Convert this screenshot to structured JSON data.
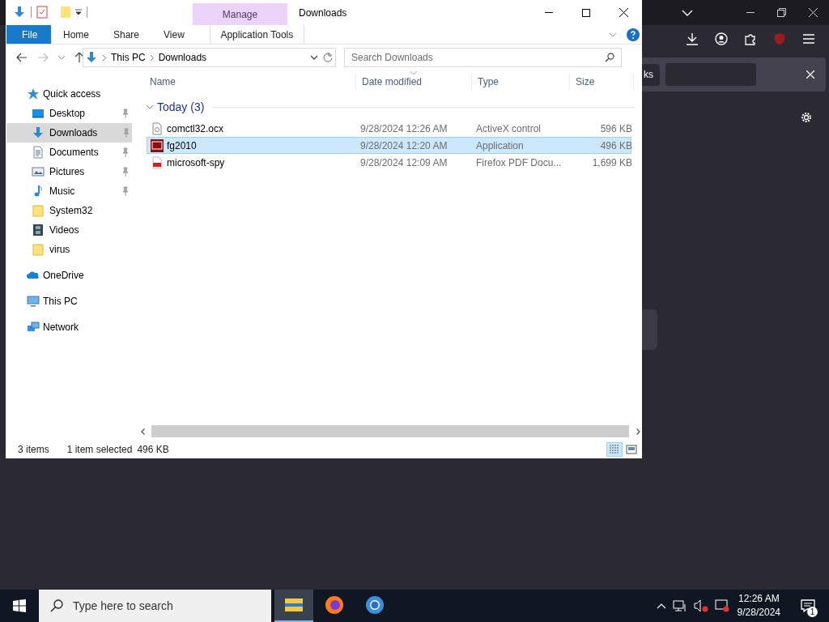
{
  "explorer": {
    "title": "Downloads",
    "context_group": "Manage",
    "ribbon_tabs": [
      {
        "label": "File",
        "kind": "file"
      },
      {
        "label": "Home",
        "kind": "tab"
      },
      {
        "label": "Share",
        "kind": "tab"
      },
      {
        "label": "View",
        "kind": "tab"
      },
      {
        "label": "Application Tools",
        "kind": "context"
      }
    ],
    "address": [
      "This PC",
      "Downloads"
    ],
    "search": {
      "placeholder": "Search Downloads"
    },
    "nav": [
      {
        "label": "Quick access",
        "kind": "star",
        "selected": false,
        "children": [
          {
            "label": "Desktop",
            "kind": "desktop",
            "pinned": true,
            "selected": false
          },
          {
            "label": "Downloads",
            "kind": "downloads",
            "pinned": true,
            "selected": true
          },
          {
            "label": "Documents",
            "kind": "documents",
            "pinned": true,
            "selected": false
          },
          {
            "label": "Pictures",
            "kind": "pictures",
            "pinned": true,
            "selected": false
          },
          {
            "label": "Music",
            "kind": "music",
            "pinned": true,
            "selected": false
          },
          {
            "label": "System32",
            "kind": "folder",
            "pinned": false,
            "selected": false
          },
          {
            "label": "Videos",
            "kind": "videos",
            "pinned": false,
            "selected": false
          },
          {
            "label": "virus",
            "kind": "folder",
            "pinned": false,
            "selected": false
          }
        ]
      },
      {
        "label": "OneDrive",
        "kind": "cloud",
        "selected": false
      },
      {
        "label": "This PC",
        "kind": "pc",
        "selected": false
      },
      {
        "label": "Network",
        "kind": "network",
        "selected": false
      }
    ],
    "columns": [
      "Name",
      "Date modified",
      "Type",
      "Size"
    ],
    "group": {
      "label": "Today (3)",
      "expanded": true
    },
    "rows": [
      {
        "kind": "ocx",
        "name": "comctl32.ocx",
        "date": "9/28/2024 12:26 AM",
        "type": "ActiveX control",
        "size": "596 KB",
        "selected": false
      },
      {
        "kind": "app",
        "name": "fg2010",
        "date": "9/28/2024 12:20 AM",
        "type": "Application",
        "size": "496 KB",
        "selected": true
      },
      {
        "kind": "pdf",
        "name": "microsoft-spy",
        "date": "9/28/2024 12:09 AM",
        "type": "Firefox PDF Docu...",
        "size": "1,699 KB",
        "selected": false
      }
    ],
    "status": {
      "count": "3 items",
      "selection": "1 item selected",
      "size": "496 KB"
    },
    "views": [
      {
        "kind": "details",
        "selected": true
      },
      {
        "kind": "large-icons",
        "selected": false
      }
    ]
  },
  "browser": {
    "find_button": "ks"
  },
  "taskbar": {
    "search": {
      "placeholder": "Type here to search"
    },
    "apps": [
      {
        "kind": "explorer",
        "active": true
      },
      {
        "kind": "firefox",
        "active": false
      },
      {
        "kind": "chrome",
        "active": false
      }
    ],
    "time": "12:26 AM",
    "date": "9/28/2024",
    "notifications": "1"
  }
}
